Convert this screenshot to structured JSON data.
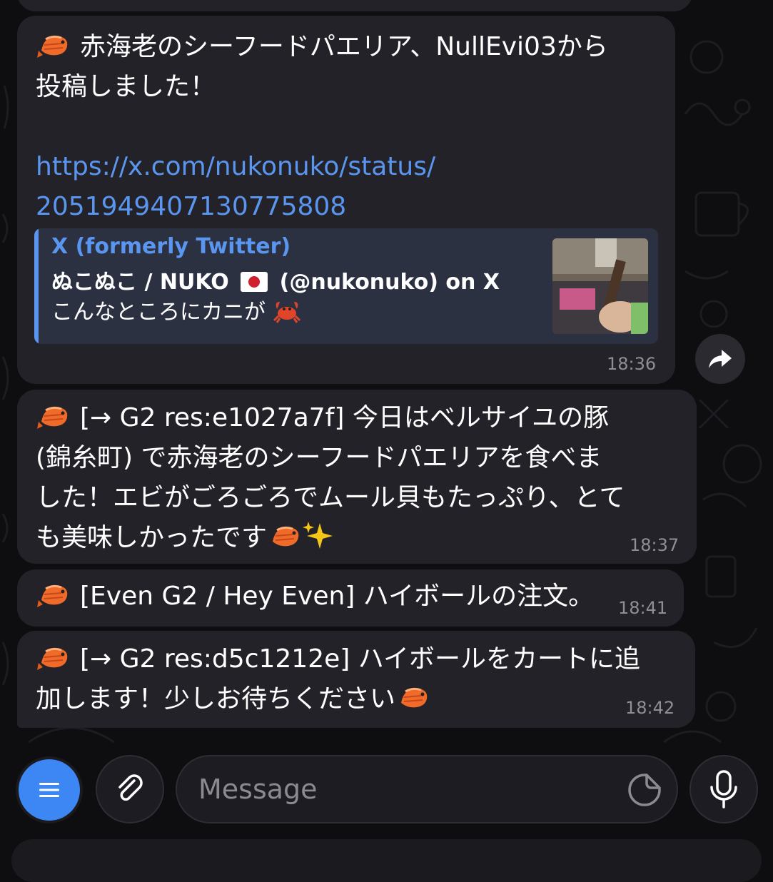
{
  "messages": [
    {
      "text_line1": "赤海老のシーフードパエリア、NullEvi03から",
      "text_line2": "投稿しました！",
      "link_line1": "https://x.com/nukonuko/status/",
      "link_line2": "2051949407130775808",
      "preview": {
        "site": "X (formerly Twitter)",
        "title_prefix": "ぬこぬこ / NUKO",
        "title_suffix": "(@nukonuko) on X",
        "description": "こんなところにカニが"
      },
      "time": "18:36"
    },
    {
      "line1": "[→ G2 res:e1027a7f] 今日はベルサイユの豚",
      "line2": "(錦糸町) で赤海老のシーフードパエリアを食べま",
      "line3": "した！エビがごろごろでムール貝もたっぷり、とて",
      "line4": "も美味しかったです",
      "time": "18:37"
    },
    {
      "text": "[Even G2 / Hey Even] ハイボールの注文。",
      "time": "18:41"
    },
    {
      "line1": "[→ G2 res:d5c1212e] ハイボールをカートに追",
      "line2": "加します！少しお待ちください",
      "time": "18:42"
    }
  ],
  "composer": {
    "placeholder": "Message"
  },
  "icons": {
    "menu": "menu-icon",
    "attach": "paperclip-icon",
    "sticker": "sticker-icon",
    "mic": "microphone-icon",
    "forward": "forward-icon"
  },
  "colors": {
    "accent": "#3d87f5",
    "link": "#5a96f0",
    "bubble": "#232228",
    "background": "#0e0e11"
  }
}
